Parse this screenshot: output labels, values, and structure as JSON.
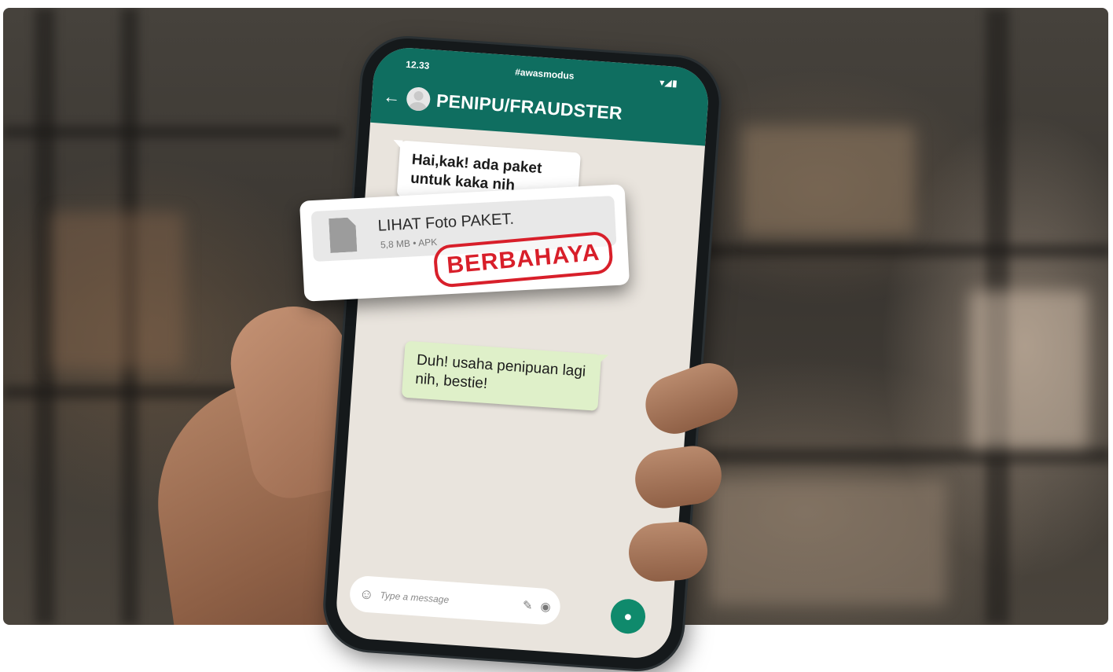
{
  "status_bar": {
    "time": "12.33",
    "hashtag": "#awasmodus",
    "icons": "▾◢▮"
  },
  "chat": {
    "contact_name": "PENIPU/FRAUDSTER",
    "messages": [
      {
        "from": "contact",
        "text": "Hai,kak! ada paket untuk kaka nih"
      },
      {
        "from": "me",
        "text": "Duh! usaha penipuan lagi nih, bestie!"
      }
    ],
    "attachment": {
      "name": "LIHAT Foto PAKET.",
      "meta": "5,8 MB • APK",
      "stamp": "BERBAHAYA",
      "stamp_color": "#d81f2a"
    },
    "input_placeholder": "Type a message"
  },
  "colors": {
    "header": "#0f6e60",
    "outgoing_bubble": "#dff0c9",
    "mic_button": "#0f8a6c"
  }
}
